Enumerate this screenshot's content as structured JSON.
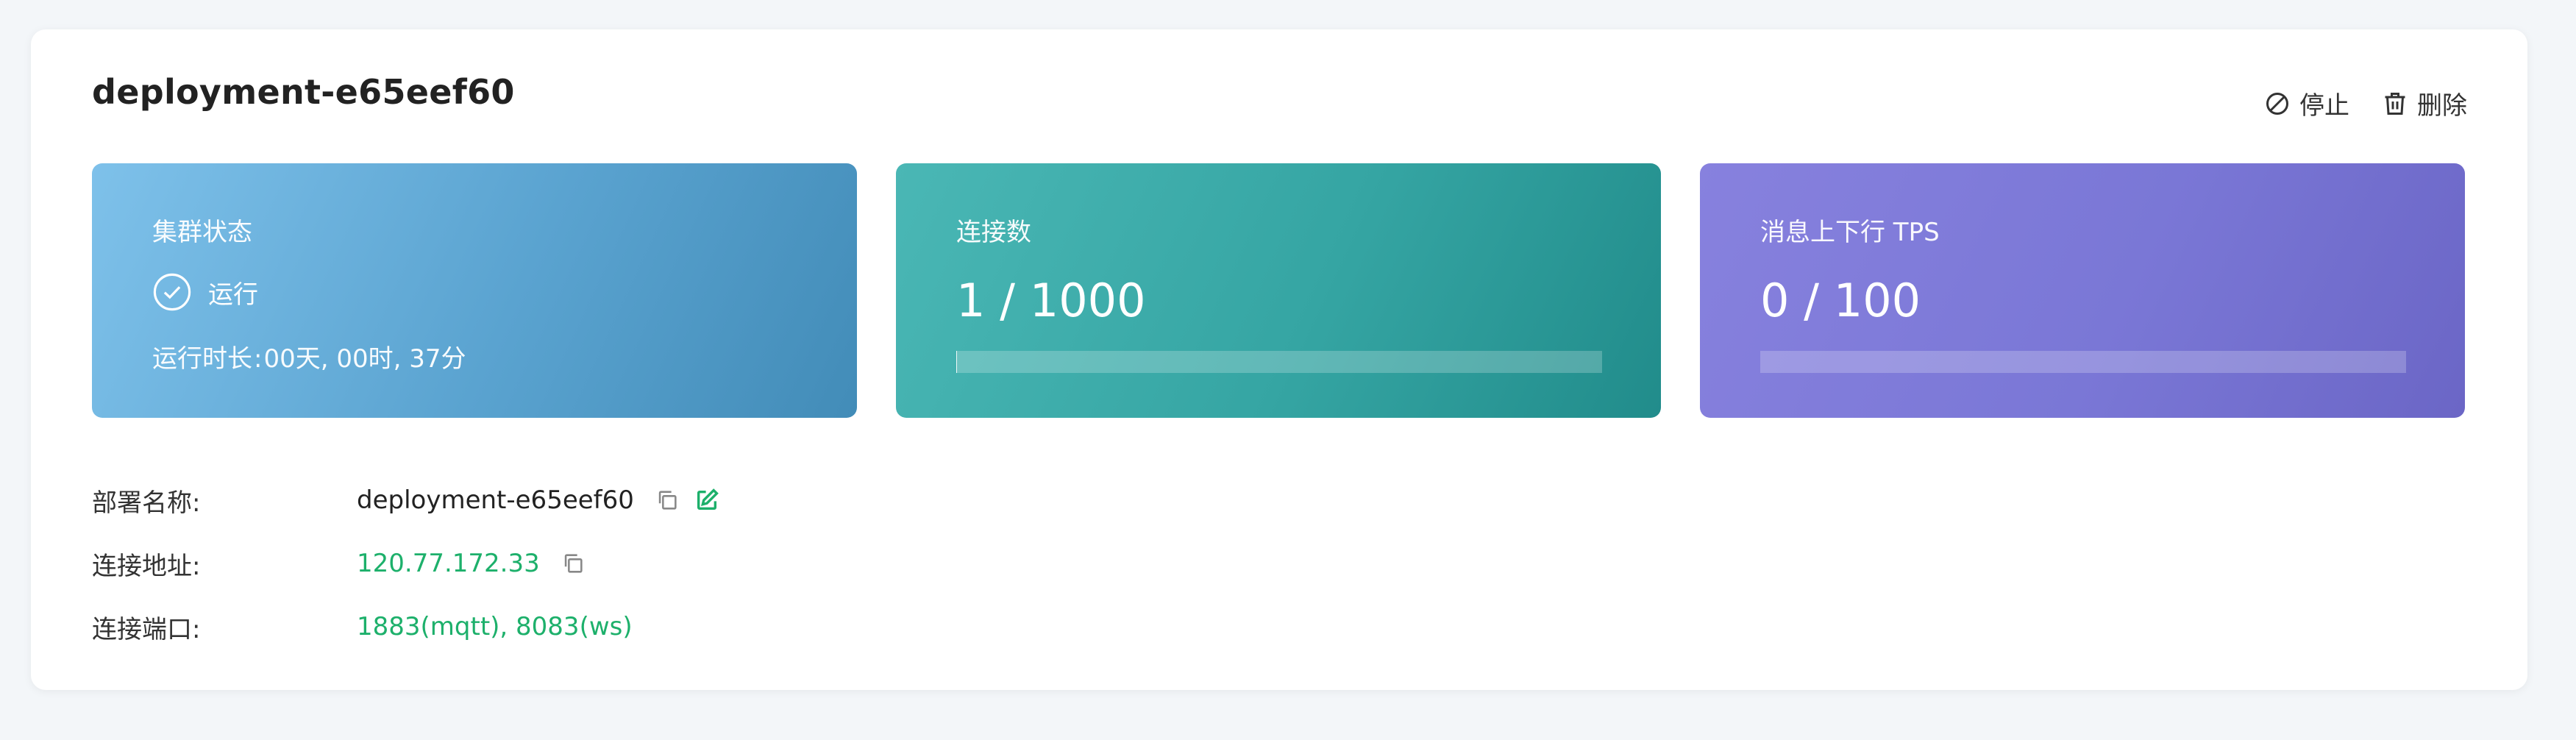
{
  "header": {
    "title": "deployment-e65eef60",
    "stop_label": "停止",
    "delete_label": "删除"
  },
  "cards": {
    "cluster_status": {
      "label": "集群状态",
      "status": "运行",
      "uptime_label": "运行时长",
      "uptime_value": "00天, 00时, 37分"
    },
    "connections": {
      "label": "连接数",
      "value_text": "1 / 1000",
      "fraction": 0.001
    },
    "tps": {
      "label": "消息上下行 TPS",
      "value_text": "0 / 100",
      "fraction": 0
    }
  },
  "details": {
    "name_label": "部署名称:",
    "name_value": "deployment-e65eef60",
    "address_label": "连接地址:",
    "address_value": "120.77.172.33",
    "port_label": "连接端口:",
    "port_value": "1883(mqtt), 8083(ws)"
  },
  "colors": {
    "accent_green": "#1db06b",
    "status_card": "#5aa3d0",
    "connections_card": "#35a5a3",
    "tps_card": "#7a77d6"
  },
  "icons": {
    "stop": "ban-icon",
    "delete": "trash-icon",
    "status": "check-circle-icon",
    "copy": "copy-icon",
    "edit": "edit-icon"
  }
}
